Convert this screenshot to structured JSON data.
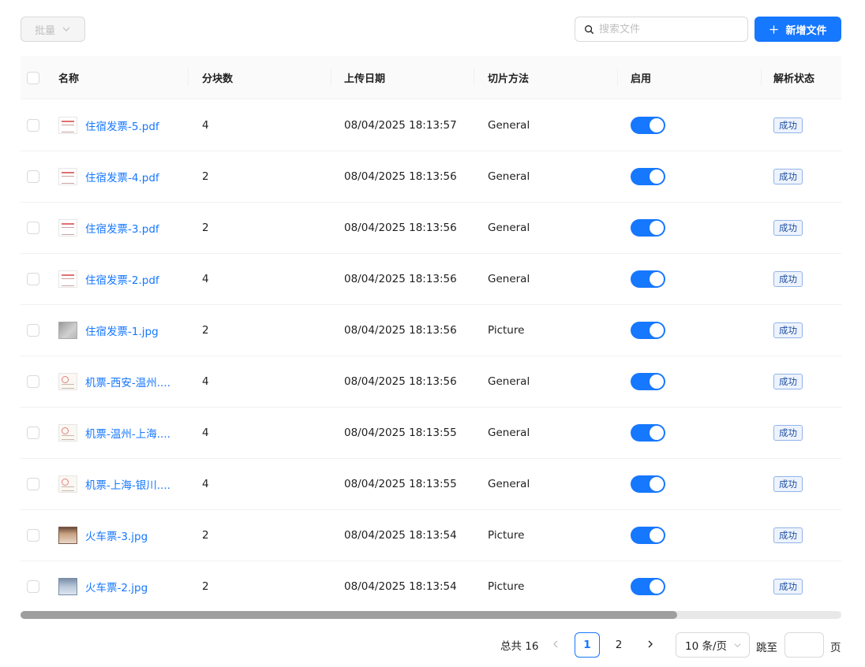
{
  "toolbar": {
    "batch_label": "批量",
    "search_placeholder": "搜索文件",
    "add_label": "新增文件"
  },
  "table": {
    "columns": [
      "名称",
      "分块数",
      "上传日期",
      "切片方法",
      "启用",
      "解析状态"
    ],
    "rows": [
      {
        "name": "住宿发票-5.pdf",
        "thumb": "pdf",
        "chunks": "4",
        "date": "08/04/2025 18:13:57",
        "method": "General",
        "enabled": true,
        "status": "成功"
      },
      {
        "name": "住宿发票-4.pdf",
        "thumb": "pdf",
        "chunks": "2",
        "date": "08/04/2025 18:13:56",
        "method": "General",
        "enabled": true,
        "status": "成功"
      },
      {
        "name": "住宿发票-3.pdf",
        "thumb": "pdf",
        "chunks": "2",
        "date": "08/04/2025 18:13:56",
        "method": "General",
        "enabled": true,
        "status": "成功"
      },
      {
        "name": "住宿发票-2.pdf",
        "thumb": "pdf",
        "chunks": "4",
        "date": "08/04/2025 18:13:56",
        "method": "General",
        "enabled": true,
        "status": "成功"
      },
      {
        "name": "住宿发票-1.jpg",
        "thumb": "photo",
        "chunks": "2",
        "date": "08/04/2025 18:13:56",
        "method": "Picture",
        "enabled": true,
        "status": "成功"
      },
      {
        "name": "机票-西安-温州....",
        "thumb": "ticket",
        "chunks": "4",
        "date": "08/04/2025 18:13:56",
        "method": "General",
        "enabled": true,
        "status": "成功"
      },
      {
        "name": "机票-温州-上海....",
        "thumb": "ticket",
        "chunks": "4",
        "date": "08/04/2025 18:13:55",
        "method": "General",
        "enabled": true,
        "status": "成功"
      },
      {
        "name": "机票-上海-银川....",
        "thumb": "ticket",
        "chunks": "4",
        "date": "08/04/2025 18:13:55",
        "method": "General",
        "enabled": true,
        "status": "成功"
      },
      {
        "name": "火车票-3.jpg",
        "thumb": "train",
        "chunks": "2",
        "date": "08/04/2025 18:13:54",
        "method": "Picture",
        "enabled": true,
        "status": "成功"
      },
      {
        "name": "火车票-2.jpg",
        "thumb": "train2",
        "chunks": "2",
        "date": "08/04/2025 18:13:54",
        "method": "Picture",
        "enabled": true,
        "status": "成功"
      }
    ]
  },
  "pagination": {
    "total_label": "总共 16",
    "pages": [
      "1",
      "2"
    ],
    "current_page": "1",
    "page_size_label": "10 条/页",
    "jump_label": "跳至",
    "jump_suffix": "页"
  },
  "colors": {
    "primary": "#1677ff",
    "success_tag_border": "#91b3e8"
  }
}
